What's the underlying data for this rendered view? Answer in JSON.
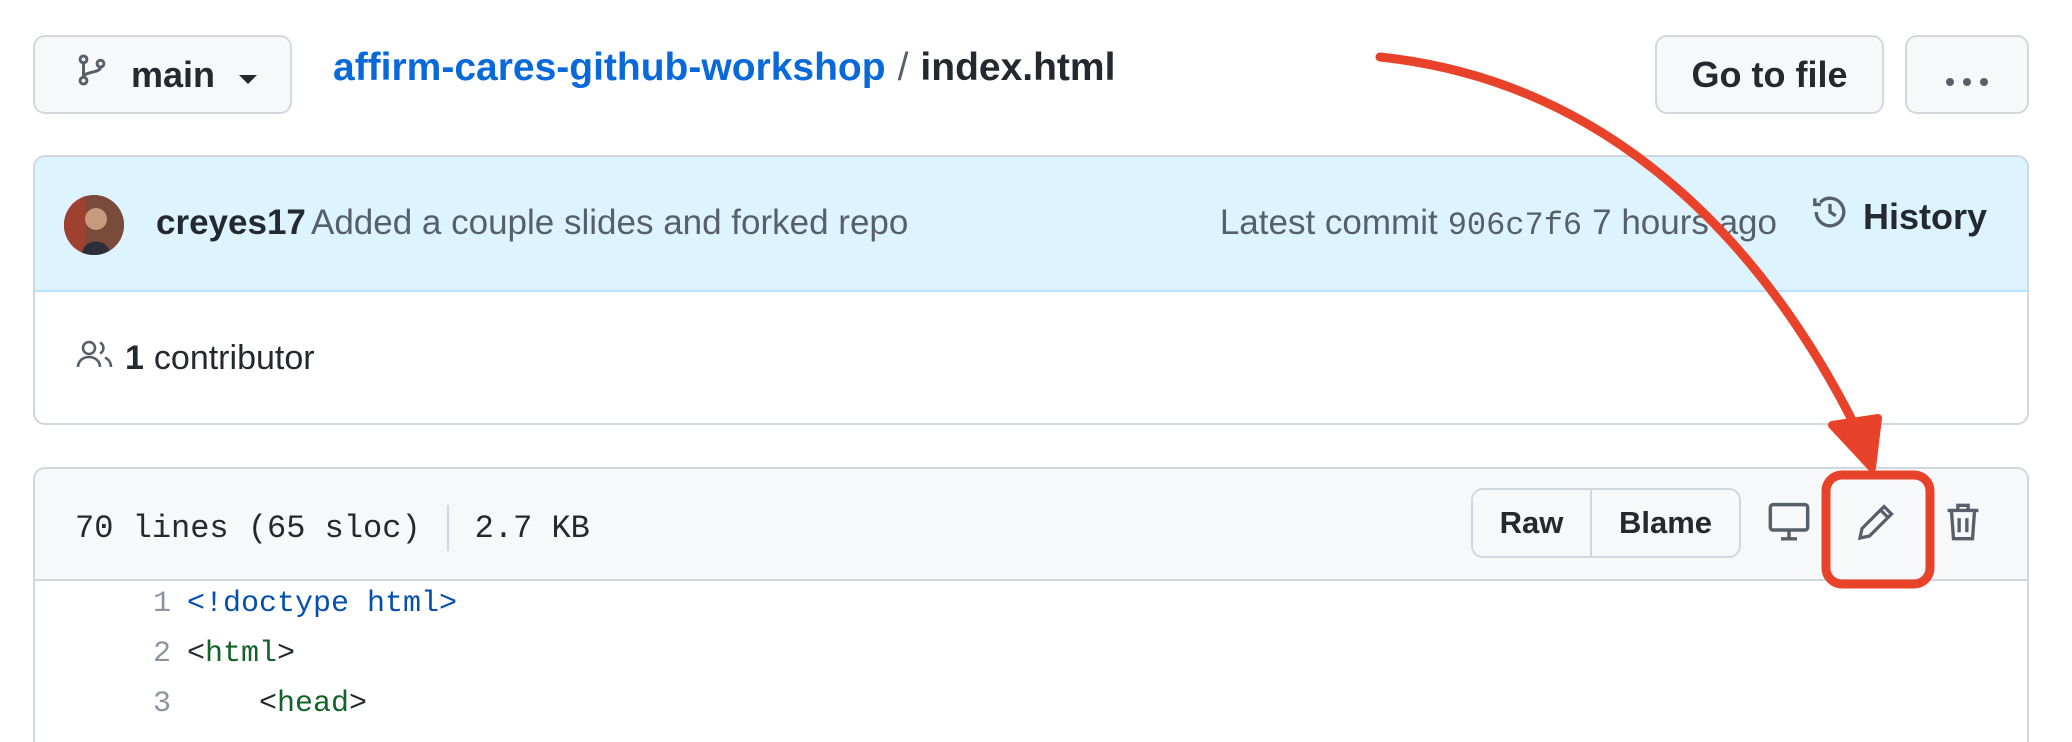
{
  "branch": {
    "name": "main"
  },
  "breadcrumb": {
    "repo": "affirm-cares-github-workshop",
    "separator": "/",
    "file": "index.html"
  },
  "actions": {
    "goto_file": "Go to file",
    "more": "···"
  },
  "commit": {
    "author": "creyes17",
    "message": "Added a couple slides and forked repo",
    "latest_label": "Latest commit",
    "sha": "906c7f6",
    "time": "7 hours ago",
    "history_label": "History"
  },
  "contributors": {
    "count": "1",
    "label": "contributor"
  },
  "file": {
    "lines": "70 lines (65 sloc)",
    "size": "2.7 KB",
    "raw_label": "Raw",
    "blame_label": "Blame"
  },
  "code": {
    "lines": [
      {
        "num": "1",
        "text": "<!doctype html>"
      },
      {
        "num": "2",
        "text_open": "<",
        "text_tag": "html",
        "text_close": ">",
        "indent": ""
      },
      {
        "num": "3",
        "text_open": "<",
        "text_tag": "head",
        "text_close": ">",
        "indent": "    "
      }
    ]
  },
  "colors": {
    "link": "#0969da",
    "commit_bar": "#ddf4ff",
    "annotation": "#e8432a"
  },
  "icons": [
    "branch-icon",
    "caret-down-icon",
    "history-icon",
    "people-icon",
    "desktop-icon",
    "pencil-icon",
    "trash-icon",
    "kebab-icon"
  ]
}
